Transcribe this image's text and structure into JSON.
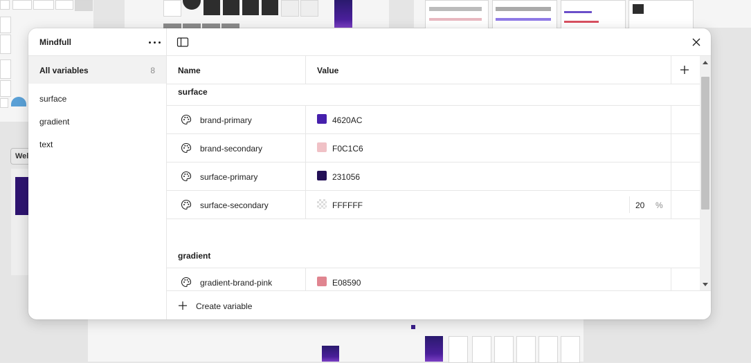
{
  "collection": {
    "title": "Mindfull",
    "more_icon": "more-horizontal-icon"
  },
  "sidebar": {
    "all_label": "All variables",
    "all_count": "8",
    "groups": [
      "surface",
      "gradient",
      "text"
    ]
  },
  "table": {
    "col_name": "Name",
    "col_value": "Value",
    "sections": [
      {
        "title": "surface",
        "rows": [
          {
            "name": "brand-primary",
            "color": "#4620AC",
            "hex": "4620AC"
          },
          {
            "name": "brand-secondary",
            "color": "#F0C1C6",
            "hex": "F0C1C6"
          },
          {
            "name": "surface-primary",
            "color": "#231056",
            "hex": "231056"
          },
          {
            "name": "surface-secondary",
            "color": "#FFFFFF",
            "hex": "FFFFFF",
            "opacity": "20",
            "opacity_unit": "%"
          }
        ]
      },
      {
        "title": "gradient",
        "rows": [
          {
            "name": "gradient-brand-pink",
            "color": "#E08590",
            "hex": "E08590"
          }
        ]
      }
    ]
  },
  "footer": {
    "create_label": "Create variable"
  },
  "icons": {
    "row_icon": "palette-icon",
    "panel_toggle": "sidebar-toggle-icon",
    "close": "close-icon",
    "add": "plus-icon"
  },
  "background": {
    "frame_label": "Wel",
    "card_label": "Mindfull"
  }
}
